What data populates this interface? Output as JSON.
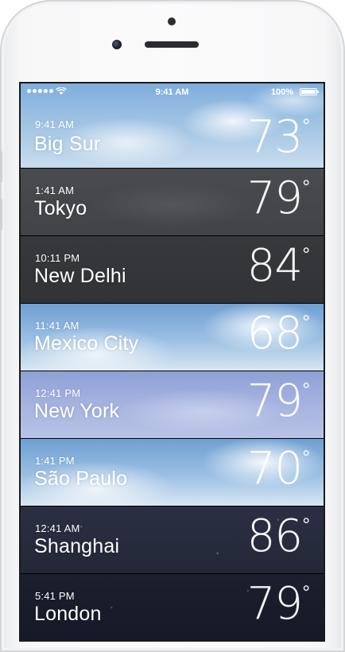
{
  "status_bar": {
    "time": "9:41 AM",
    "battery": "100%"
  },
  "cities": [
    {
      "time": "9:41 AM",
      "city": "Big Sur",
      "temp": "73",
      "theme": "sky-day"
    },
    {
      "time": "1:41 AM",
      "city": "Tokyo",
      "temp": "79",
      "theme": "sky-dark"
    },
    {
      "time": "10:11 PM",
      "city": "New Delhi",
      "temp": "84",
      "theme": "sky-darker"
    },
    {
      "time": "11:41 AM",
      "city": "Mexico City",
      "temp": "68",
      "theme": "sky-clouds"
    },
    {
      "time": "12:41 PM",
      "city": "New York",
      "temp": "79",
      "theme": "sky-purple"
    },
    {
      "time": "1:41 PM",
      "city": "São Paulo",
      "temp": "70",
      "theme": "sky-clouds"
    },
    {
      "time": "12:41 AM",
      "city": "Shanghai",
      "temp": "86",
      "theme": "night"
    },
    {
      "time": "5:41 PM",
      "city": "London",
      "temp": "79",
      "theme": "night-deep"
    }
  ],
  "degree_symbol": "°",
  "icons": {
    "signal": "signal-dots-icon",
    "wifi": "wifi-icon",
    "battery": "battery-icon"
  }
}
